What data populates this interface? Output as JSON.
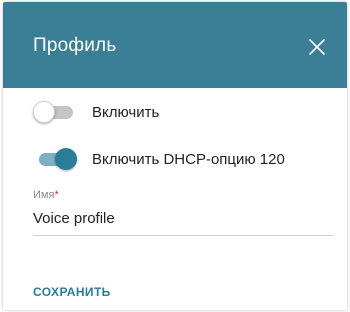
{
  "dialog": {
    "title": "Профиль",
    "close_icon": "close-icon"
  },
  "toggles": [
    {
      "label": "Включить",
      "state": "off"
    },
    {
      "label": "Включить DHCP-опцию 120",
      "state": "on"
    }
  ],
  "name_field": {
    "label": "Имя",
    "required_mark": "*",
    "value": "Voice profile"
  },
  "actions": {
    "save_label": "СОХРАНИТЬ"
  },
  "colors": {
    "header_bg": "#3b7f97",
    "accent": "#2b7c98",
    "required": "#d0321e"
  }
}
